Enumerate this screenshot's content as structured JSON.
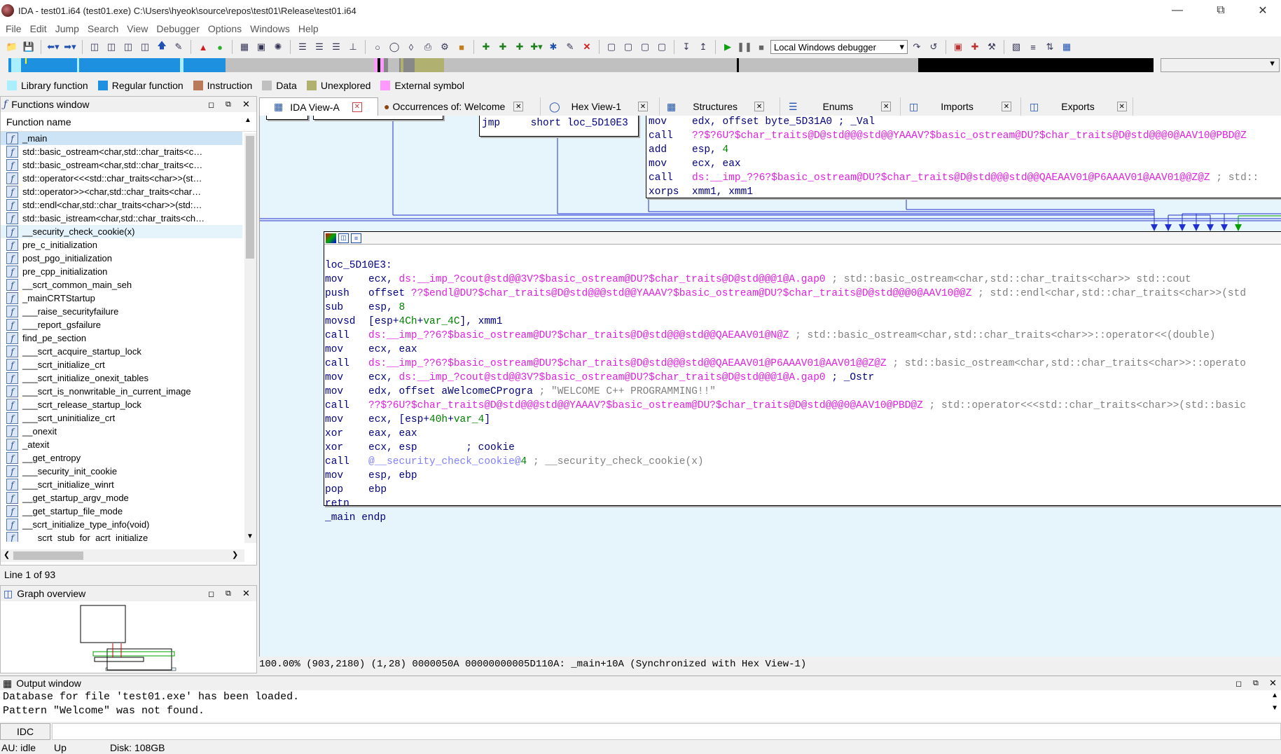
{
  "window": {
    "title": "IDA - test01.i64 (test01.exe) C:\\Users\\hyeok\\source\\repos\\test01\\Release\\test01.i64"
  },
  "menu": [
    "File",
    "Edit",
    "Jump",
    "Search",
    "View",
    "Debugger",
    "Options",
    "Windows",
    "Help"
  ],
  "toolbar": {
    "debugger_select": "Local Windows debugger"
  },
  "legend": [
    {
      "label": "Library function",
      "color": "#aaeeff"
    },
    {
      "label": "Regular function",
      "color": "#1e90e0"
    },
    {
      "label": "Instruction",
      "color": "#b87a5a"
    },
    {
      "label": "Data",
      "color": "#c0c0c0"
    },
    {
      "label": "Unexplored",
      "color": "#b0b070"
    },
    {
      "label": "External symbol",
      "color": "#ff99ff"
    }
  ],
  "functions_window": {
    "title": "Functions window",
    "column": "Function name",
    "items": [
      "_main",
      "std::basic_ostream<char,std::char_traits<c…",
      "std::basic_ostream<char,std::char_traits<c…",
      "std::operator<<<std::char_traits<char>>(st…",
      "std::operator>><char,std::char_traits<char…",
      "std::endl<char,std::char_traits<char>>(std:…",
      "std::basic_istream<char,std::char_traits<ch…",
      "__security_check_cookie(x)",
      "pre_c_initialization",
      "post_pgo_initialization",
      "pre_cpp_initialization",
      "__scrt_common_main_seh",
      "_mainCRTStartup",
      "___raise_securityfailure",
      "___report_gsfailure",
      "find_pe_section",
      "___scrt_acquire_startup_lock",
      "___scrt_initialize_crt",
      "___scrt_initialize_onexit_tables",
      "___scrt_is_nonwritable_in_current_image",
      "___scrt_release_startup_lock",
      "___scrt_uninitialize_crt",
      "__onexit",
      "_atexit",
      "__get_entropy",
      "___security_init_cookie",
      "___scrt_initialize_winrt",
      "__get_startup_argv_mode",
      "__get_startup_file_mode",
      "__scrt_initialize_type_info(void)",
      "___scrt_stub_for_acrt_initialize"
    ],
    "line_status": "Line 1 of 93"
  },
  "graph_overview": {
    "title": "Graph overview"
  },
  "tabs": [
    {
      "label": "IDA View-A",
      "active": true
    },
    {
      "label": "Occurrences of: Welcome",
      "active": false
    },
    {
      "label": "Hex View-1",
      "active": false
    },
    {
      "label": "Structures",
      "active": false
    },
    {
      "label": "Enums",
      "active": false
    },
    {
      "label": "Imports",
      "active": false
    },
    {
      "label": "Exports",
      "active": false
    }
  ],
  "top_block": {
    "jmp": "jmp     short loc_5D10E3"
  },
  "right_block": [
    {
      "m": "mov",
      "a": "edx, offset byte_5D31A0 ; _Val"
    },
    {
      "m": "call",
      "a": "??$?6U?$char_traits@D@std@@@std@@YAAAV?$basic_ostream@DU?$char_traits@D@std@@@0@AAV10@PBD@Z"
    },
    {
      "m": "add",
      "a": "esp, 4"
    },
    {
      "m": "mov",
      "a": "ecx, eax"
    },
    {
      "m": "call",
      "a": "ds:__imp_??6?$basic_ostream@DU?$char_traits@D@std@@@std@@QAEAAV01@P6AAAV01@AAV01@@Z@Z ; std::"
    },
    {
      "m": "xorps",
      "a": "xmm1, xmm1"
    }
  ],
  "main_block": {
    "label": "loc_5D10E3:",
    "lines": [
      {
        "m": "mov",
        "a": "ecx, ds:__imp_?cout@std@@3V?$basic_ostream@DU?$char_traits@D@std@@@1@A.gap0 ; std::basic_ostream<char,std::char_traits<char>> std::cout"
      },
      {
        "m": "push",
        "a": "offset ??$endl@DU?$char_traits@D@std@@@std@@YAAAV?$basic_ostream@DU?$char_traits@D@std@@@0@AAV10@@Z ; std::endl<char,std::char_traits<char>>(std"
      },
      {
        "m": "sub",
        "a": "esp, 8"
      },
      {
        "m": "movsd",
        "a": "[esp+4Ch+var_4C], xmm1"
      },
      {
        "m": "call",
        "a": "ds:__imp_??6?$basic_ostream@DU?$char_traits@D@std@@@std@@QAEAAV01@N@Z ; std::basic_ostream<char,std::char_traits<char>>::operator<<(double)"
      },
      {
        "m": "mov",
        "a": "ecx, eax"
      },
      {
        "m": "call",
        "a": "ds:__imp_??6?$basic_ostream@DU?$char_traits@D@std@@@std@@QAEAAV01@P6AAAV01@AAV01@@Z@Z ; std::basic_ostream<char,std::char_traits<char>>::operato"
      },
      {
        "m": "mov",
        "a": "ecx, ds:__imp_?cout@std@@3V?$basic_ostream@DU?$char_traits@D@std@@@1@A.gap0 ; _Ostr"
      },
      {
        "m": "mov",
        "a": "edx, offset aWelcomeCProgra ; \"WELCOME C++ PROGRAMMING!!\""
      },
      {
        "m": "call",
        "a": "??$?6U?$char_traits@D@std@@@std@@YAAAV?$basic_ostream@DU?$char_traits@D@std@@@0@AAV10@PBD@Z ; std::operator<<<std::char_traits<char>>(std::basic"
      },
      {
        "m": "mov",
        "a": "ecx, [esp+40h+var_4]"
      },
      {
        "m": "xor",
        "a": "eax, eax"
      },
      {
        "m": "xor",
        "a": "ecx, esp        ; cookie"
      },
      {
        "m": "call",
        "a": "@__security_check_cookie@4 ; __security_check_cookie(x)"
      },
      {
        "m": "mov",
        "a": "esp, ebp"
      },
      {
        "m": "pop",
        "a": "ebp"
      },
      {
        "m": "retn",
        "a": ""
      }
    ],
    "end": "_main endp"
  },
  "status_line": "100.00% (903,2180) (1,28) 0000050A 00000000005D110A: _main+10A (Synchronized with Hex View-1)",
  "output": {
    "title": "Output window",
    "lines": [
      "Database for file 'test01.exe' has been loaded.",
      "Pattern \"Welcome\" was not found."
    ],
    "idc_label": "IDC"
  },
  "statusbar": {
    "au_label": "AU:",
    "au_state": "idle",
    "dir": "Up",
    "disk": "Disk: 108GB"
  }
}
